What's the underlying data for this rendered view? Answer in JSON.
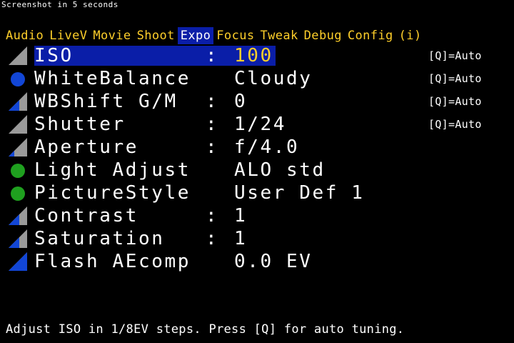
{
  "top_note": "Screenshot in 5 seconds",
  "tabs": [
    {
      "label": "Audio",
      "active": false
    },
    {
      "label": "LiveV",
      "active": false
    },
    {
      "label": "Movie",
      "active": false
    },
    {
      "label": "Shoot",
      "active": false
    },
    {
      "label": "Expo",
      "active": true
    },
    {
      "label": "Focus",
      "active": false
    },
    {
      "label": "Tweak",
      "active": false
    },
    {
      "label": "Debug",
      "active": false
    },
    {
      "label": "Config",
      "active": false
    },
    {
      "label": "(i)",
      "active": false
    }
  ],
  "menu_items": [
    {
      "name": "ISO",
      "value": "100",
      "q": "[Q]=Auto",
      "icon": "gray-triangle-icon",
      "selected": true
    },
    {
      "name": "WhiteBalance",
      "value": "Cloudy",
      "q": "[Q]=Auto",
      "icon": "blue-dot-icon",
      "selected": false
    },
    {
      "name": "WBShift G/M",
      "value": "0",
      "q": "[Q]=Auto",
      "icon": "blue-triangle-icon",
      "selected": false
    },
    {
      "name": "Shutter",
      "value": "1/24",
      "q": "[Q]=Auto",
      "icon": "gray-triangle-icon",
      "selected": false
    },
    {
      "name": "Aperture",
      "value": "f/4.0",
      "q": "",
      "icon": "blue-gray-triangle-icon",
      "selected": false
    },
    {
      "name": "Light Adjust",
      "value": "ALO std",
      "q": "",
      "icon": "green-dot-icon",
      "selected": false
    },
    {
      "name": "PictureStyle",
      "value": "User Def 1",
      "q": "",
      "icon": "green-dot-icon",
      "selected": false
    },
    {
      "name": "Contrast",
      "value": "1",
      "q": "",
      "icon": "blue-triangle-icon",
      "selected": false
    },
    {
      "name": "Saturation",
      "value": "1",
      "q": "",
      "icon": "blue-triangle-icon",
      "selected": false
    },
    {
      "name": "Flash AEcomp",
      "value": "0.0 EV",
      "q": "",
      "icon": "blue-triangle-icon",
      "selected": false
    }
  ],
  "colon": ":",
  "help_text": "Adjust ISO in 1/8EV steps. Press [Q] for auto tuning.",
  "colors": {
    "accent_yellow": "#ffcf2a",
    "select_blue": "#0a1ea8",
    "blue": "#1246d6",
    "green": "#1fa01f",
    "gray": "#9a9a9a"
  }
}
